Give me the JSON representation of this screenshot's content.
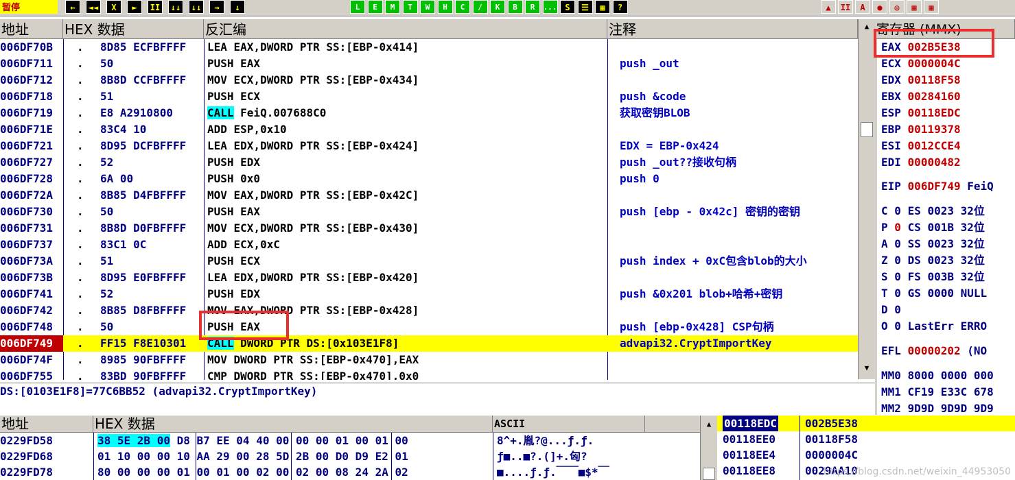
{
  "toolbar": {
    "state": "暂停",
    "buttons": [
      "←",
      "◄◄",
      "X",
      "►",
      "II",
      "↓↓",
      "↓↓",
      "→",
      "↓",
      "L",
      "E",
      "M",
      "T",
      "W",
      "H",
      "C",
      "/",
      "K",
      "B",
      "R",
      "...",
      "S",
      "☰",
      "▦",
      "?"
    ],
    "right_buttons": [
      "▲",
      "II",
      "A",
      "●",
      "◎",
      "▦",
      "▦"
    ]
  },
  "disasm_headers": {
    "addr": "地址",
    "hex": "HEX 数据",
    "asm": "反汇编",
    "comment": "注释"
  },
  "disasm_rows": [
    {
      "addr": "006DF70B",
      "mark": ".",
      "hex": "8D85 ECFBFFFF",
      "asm": "LEA EAX,DWORD PTR SS:[EBP-0x414]",
      "comment": ""
    },
    {
      "addr": "006DF711",
      "mark": ".",
      "hex": "50",
      "asm": "PUSH EAX",
      "comment": "push _out"
    },
    {
      "addr": "006DF712",
      "mark": ".",
      "hex": "8B8D CCFBFFFF",
      "asm": "MOV ECX,DWORD PTR SS:[EBP-0x434]",
      "comment": ""
    },
    {
      "addr": "006DF718",
      "mark": ".",
      "hex": "51",
      "asm": "PUSH ECX",
      "comment": "push &code"
    },
    {
      "addr": "006DF719",
      "mark": ".",
      "hex": "E8 A2910800",
      "asm_call": "CALL",
      "asm_rest": " FeiQ.007688C0",
      "comment": "获取密钥BLOB"
    },
    {
      "addr": "006DF71E",
      "mark": ".",
      "hex": "83C4 10",
      "asm": "ADD ESP,0x10",
      "comment": ""
    },
    {
      "addr": "006DF721",
      "mark": ".",
      "hex": "8D95 DCFBFFFF",
      "asm": "LEA EDX,DWORD PTR SS:[EBP-0x424]",
      "comment": "EDX = EBP-0x424"
    },
    {
      "addr": "006DF727",
      "mark": ".",
      "hex": "52",
      "asm": "PUSH EDX",
      "comment": "push _out??接收句柄"
    },
    {
      "addr": "006DF728",
      "mark": ".",
      "hex": "6A 00",
      "asm": "PUSH 0x0",
      "comment": "push 0"
    },
    {
      "addr": "006DF72A",
      "mark": ".",
      "hex": "8B85 D4FBFFFF",
      "asm": "MOV EAX,DWORD PTR SS:[EBP-0x42C]",
      "comment": ""
    },
    {
      "addr": "006DF730",
      "mark": ".",
      "hex": "50",
      "asm": "PUSH EAX",
      "comment": "push [ebp - 0x42c] 密钥的密钥"
    },
    {
      "addr": "006DF731",
      "mark": ".",
      "hex": "8B8D D0FBFFFF",
      "asm": "MOV ECX,DWORD PTR SS:[EBP-0x430]",
      "comment": ""
    },
    {
      "addr": "006DF737",
      "mark": ".",
      "hex": "83C1 0C",
      "asm": "ADD ECX,0xC",
      "comment": ""
    },
    {
      "addr": "006DF73A",
      "mark": ".",
      "hex": "51",
      "asm": "PUSH ECX",
      "comment": "push index + 0xC包含blob的大小"
    },
    {
      "addr": "006DF73B",
      "mark": ".",
      "hex": "8D95 E0FBFFFF",
      "asm": "LEA EDX,DWORD PTR SS:[EBP-0x420]",
      "comment": ""
    },
    {
      "addr": "006DF741",
      "mark": ".",
      "hex": "52",
      "asm": "PUSH EDX",
      "comment": "push &0x201 blob+哈希+密钥"
    },
    {
      "addr": "006DF742",
      "mark": ".",
      "hex": "8B85 D8FBFFFF",
      "asm": "MOV EAX,DWORD PTR SS:[EBP-0x428]",
      "comment": ""
    },
    {
      "addr": "006DF748",
      "mark": ".",
      "hex": "50",
      "asm": "PUSH EAX",
      "comment": "push [ebp-0x428]  CSP句柄"
    },
    {
      "addr": "006DF749",
      "mark": ".",
      "hex": "FF15 F8E10301",
      "asm_call": "CALL",
      "asm_rest": " DWORD PTR DS:[0x103E1F8]",
      "comment": "advapi32.CryptImportKey",
      "selected": true
    },
    {
      "addr": "006DF74F",
      "mark": ".",
      "hex": "8985 90FBFFFF",
      "asm": "MOV DWORD PTR SS:[EBP-0x470],EAX",
      "comment": ""
    },
    {
      "addr": "006DF755",
      "mark": ".",
      "hex": "83BD 90FBFFFF",
      "asm": "CMP DWORD PTR SS:[EBP-0x470],0x0",
      "comment": ""
    }
  ],
  "info_line": "DS:[0103E1F8]=77C6BB52 (advapi32.CryptImportKey)",
  "registers": {
    "header": "寄存器 (MMX)",
    "general": [
      {
        "name": "EAX",
        "value": "002B5E38",
        "extra": ""
      },
      {
        "name": "ECX",
        "value": "0000004C",
        "extra": ""
      },
      {
        "name": "EDX",
        "value": "00118F58",
        "extra": ""
      },
      {
        "name": "EBX",
        "value": "00284160",
        "extra": ""
      },
      {
        "name": "ESP",
        "value": "00118EDC",
        "extra": ""
      },
      {
        "name": "EBP",
        "value": "00119378",
        "extra": ""
      },
      {
        "name": "ESI",
        "value": "0012CCE4",
        "extra": ""
      },
      {
        "name": "EDI",
        "value": "00000482",
        "extra": ""
      }
    ],
    "eip": {
      "name": "EIP",
      "value": "006DF749",
      "extra": "FeiQ"
    },
    "flags": [
      {
        "flag": "C",
        "val": "0",
        "seg": "ES",
        "sv": "0023",
        "bits": "32位"
      },
      {
        "flag": "P",
        "val": "0",
        "seg": "CS",
        "sv": "001B",
        "bits": "32位"
      },
      {
        "flag": "A",
        "val": "0",
        "seg": "SS",
        "sv": "0023",
        "bits": "32位"
      },
      {
        "flag": "Z",
        "val": "0",
        "seg": "DS",
        "sv": "0023",
        "bits": "32位"
      },
      {
        "flag": "S",
        "val": "0",
        "seg": "FS",
        "sv": "003B",
        "bits": "32位"
      },
      {
        "flag": "T",
        "val": "0",
        "seg": "GS",
        "sv": "0000",
        "bits": "NULL"
      },
      {
        "flag": "D",
        "val": "0",
        "seg": "",
        "sv": "",
        "bits": ""
      },
      {
        "flag": "O",
        "val": "0",
        "seg": "LastErr",
        "sv": "ERRO",
        "bits": ""
      }
    ],
    "efl": {
      "name": "EFL",
      "value": "00000202",
      "extra": "(NO"
    },
    "mmx": [
      {
        "name": "MM0",
        "value": "8000 0000 000"
      },
      {
        "name": "MM1",
        "value": "CF19 E33C 678"
      },
      {
        "name": "MM2",
        "value": "9D9D 9D9D 9D9"
      }
    ]
  },
  "dump_headers": {
    "addr": "地址",
    "hex": "HEX 数据",
    "ascii": "ASCII"
  },
  "dump_rows": [
    {
      "addr": "0229FD58",
      "sel": "38 5E 2B 00",
      "hex": " D8 B7 EE 04 40 00 00 00 01 00 01 00",
      "ascii": "8^+.胤?@...ƒ.ƒ."
    },
    {
      "addr": "0229FD68",
      "sel": "",
      "hex": "01 10 00 00 10 AA 29 00 28 5D 2B 00 D0 D9 E2 01",
      "ascii": "ƒ■..■?.(]+.匈?"
    },
    {
      "addr": "0229FD78",
      "sel": "",
      "hex": "80 00 00 00 01 00 01 00 02 00 02 00 08 24 2A 02",
      "ascii": "■....ƒ.ƒ.￣￣■$*￣"
    }
  ],
  "stack_rows": [
    {
      "addr": "00118EDC",
      "value": "002B5E38",
      "selected": true
    },
    {
      "addr": "00118EE0",
      "value": "00118F58"
    },
    {
      "addr": "00118EE4",
      "value": "0000004C"
    },
    {
      "addr": "00118EE8",
      "value": "0029AA10"
    }
  ],
  "watermark": "https://blog.csdn.net/weixin_44953050",
  "colors": {
    "highlight": "#ffff00",
    "addr_text": "#000080",
    "reg_value": "#c00000",
    "call_bg": "#00ffff",
    "annotation_box": "#e8312f"
  }
}
